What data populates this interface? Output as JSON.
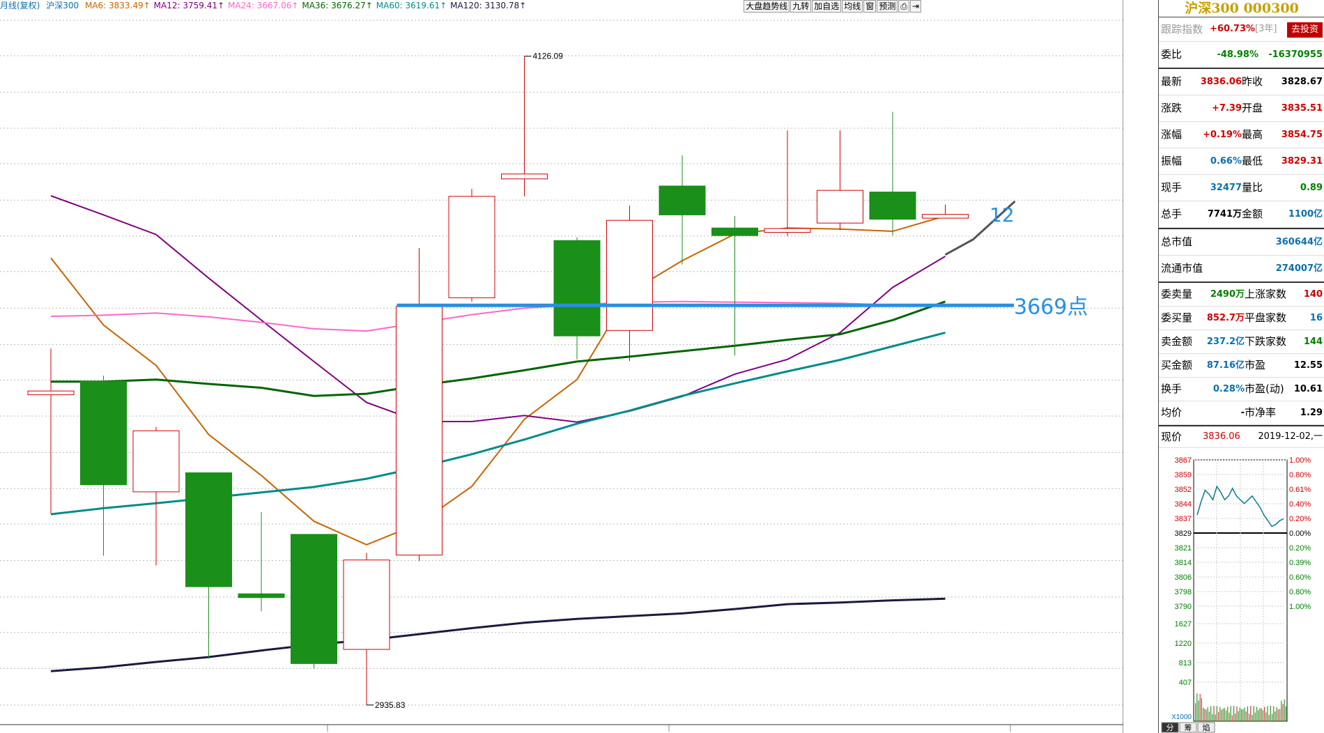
{
  "header": {
    "period_label": "月线(复权)",
    "symbol_label": "沪深300",
    "ma": [
      {
        "label": "MA6:",
        "value": "3833.49",
        "arrow": "↑",
        "color": "#c86400"
      },
      {
        "label": "MA12:",
        "value": "3759.41",
        "arrow": "↑",
        "color": "#800080"
      },
      {
        "label": "MA24:",
        "value": "3667.06",
        "arrow": "↑",
        "color": "#ff66cc"
      },
      {
        "label": "MA36:",
        "value": "3676.27",
        "arrow": "↑",
        "color": "#006400"
      },
      {
        "label": "MA60:",
        "value": "3619.61",
        "arrow": "↑",
        "color": "#008b8b"
      },
      {
        "label": "MA120:",
        "value": "3130.78",
        "arrow": "↑",
        "color": "#1a1a40"
      }
    ]
  },
  "toolbar": {
    "items": [
      "大盘趋势线",
      "九转",
      "加自选",
      "均线",
      "窗",
      "预测",
      "⎙",
      "⇥"
    ]
  },
  "chart_data": {
    "type": "candlestick",
    "y_ticks": [
      "4192",
      "4127",
      "4060",
      "3994",
      "3929",
      "3862",
      "3796",
      "3731",
      "3664",
      "3597",
      "3532",
      "3466",
      "3399",
      "3333",
      "3268",
      "3201",
      "3134",
      "3069",
      "3003",
      "2936"
    ],
    "ylim": [
      2900,
      4210
    ],
    "candles": [
      {
        "o": 3505,
        "h": 3590,
        "l": 3287,
        "c": 3512
      },
      {
        "o": 3530,
        "h": 3540,
        "l": 3210,
        "c": 3340
      },
      {
        "o": 3327,
        "h": 3446,
        "l": 3192,
        "c": 3439
      },
      {
        "o": 3362,
        "h": 3362,
        "l": 3021,
        "c": 3153
      },
      {
        "o": 3140,
        "h": 3290,
        "l": 3108,
        "c": 3133
      },
      {
        "o": 3249,
        "h": 3249,
        "l": 3003,
        "c": 3012
      },
      {
        "o": 3038,
        "h": 3215,
        "l": 2936,
        "c": 3202
      },
      {
        "o": 3211,
        "h": 3774,
        "l": 3200,
        "c": 3667
      },
      {
        "o": 3683,
        "h": 3883,
        "l": 3676,
        "c": 3869
      },
      {
        "o": 3901,
        "h": 4126,
        "l": 3869,
        "c": 3910
      },
      {
        "o": 3788,
        "h": 3794,
        "l": 3570,
        "c": 3613
      },
      {
        "o": 3623,
        "h": 3852,
        "l": 3567,
        "c": 3825
      },
      {
        "o": 3888,
        "h": 3944,
        "l": 3744,
        "c": 3835
      },
      {
        "o": 3811,
        "h": 3833,
        "l": 3577,
        "c": 3797
      },
      {
        "o": 3803,
        "h": 3990,
        "l": 3796,
        "c": 3810
      },
      {
        "o": 3820,
        "h": 3990,
        "l": 3807,
        "c": 3880
      },
      {
        "o": 3877,
        "h": 4024,
        "l": 3797,
        "c": 3827
      },
      {
        "o": 3829,
        "h": 3854,
        "l": 3829,
        "c": 3836
      }
    ],
    "series": [
      {
        "name": "MA6",
        "color": "#c86400",
        "values": [
          3756,
          3633,
          3559,
          3432,
          3357,
          3273,
          3230,
          3269,
          3337,
          3460,
          3533,
          3693,
          3751,
          3800,
          3811,
          3809,
          3805,
          3833
        ]
      },
      {
        "name": "MA12",
        "color": "#800080",
        "values": [
          3870,
          3835,
          3799,
          3719,
          3642,
          3566,
          3491,
          3456,
          3456,
          3467,
          3455,
          3475,
          3502,
          3543,
          3570,
          3619,
          3702,
          3759
        ]
      },
      {
        "name": "MA24",
        "color": "#ff66cc",
        "values": [
          3649,
          3651,
          3655,
          3648,
          3638,
          3626,
          3622,
          3637,
          3652,
          3664,
          3670,
          3675,
          3676,
          3675,
          3674,
          3673,
          3670,
          3667
        ]
      },
      {
        "name": "MA36",
        "color": "#006400",
        "values": [
          3529,
          3529,
          3533,
          3525,
          3518,
          3503,
          3507,
          3522,
          3535,
          3550,
          3566,
          3575,
          3585,
          3595,
          3606,
          3616,
          3642,
          3676
        ]
      },
      {
        "name": "MA60",
        "color": "#008b8b",
        "values": [
          3286,
          3297,
          3306,
          3316,
          3326,
          3336,
          3351,
          3372,
          3396,
          3423,
          3452,
          3476,
          3503,
          3526,
          3548,
          3569,
          3594,
          3619
        ]
      },
      {
        "name": "MA120",
        "color": "#1a1a40",
        "values": [
          2998,
          3005,
          3015,
          3024,
          3036,
          3047,
          3055,
          3066,
          3077,
          3087,
          3094,
          3099,
          3104,
          3112,
          3121,
          3124,
          3128,
          3131
        ]
      }
    ],
    "labels": {
      "high": "4126.09",
      "low": "2935.83"
    },
    "annotations": {
      "level_text": "3669点",
      "level_value": 3669,
      "count_text": "12"
    }
  },
  "panel": {
    "title": "沪深300 000300",
    "track_label": "跟踪指数",
    "track_value": "+60.73%",
    "track_years": "[3年]",
    "invest_button": "去投资",
    "weibi_label": "委比",
    "weibi_pct": "-48.98%",
    "weibi_val": "-16370955",
    "rows": [
      {
        "l1": "最新",
        "v1": "3836.06",
        "c1": "red",
        "l2": "昨收",
        "v2": "3828.67",
        "c2": "black"
      },
      {
        "l1": "涨跌",
        "v1": "+7.39",
        "c1": "red",
        "l2": "开盘",
        "v2": "3835.51",
        "c2": "red"
      },
      {
        "l1": "涨幅",
        "v1": "+0.19%",
        "c1": "red",
        "l2": "最高",
        "v2": "3854.75",
        "c2": "red"
      },
      {
        "l1": "振幅",
        "v1": "0.66%",
        "c1": "blue",
        "l2": "最低",
        "v2": "3829.31",
        "c2": "red"
      },
      {
        "l1": "现手",
        "v1": "32477",
        "c1": "blue",
        "l2": "量比",
        "v2": "0.89",
        "c2": "green"
      },
      {
        "l1": "总手",
        "v1": "7741万",
        "c1": "black",
        "l2": "金额",
        "v2": "1100亿",
        "c2": "blue"
      }
    ],
    "mkt_total_label": "总市值",
    "mkt_total": "360644亿",
    "mkt_float_label": "流通市值",
    "mkt_float": "274007亿",
    "stats": [
      {
        "l1": "委卖量",
        "v1": "2490万",
        "c1": "green",
        "l2": "上涨家数",
        "v2": "140",
        "c2": "red"
      },
      {
        "l1": "委买量",
        "v1": "852.7万",
        "c1": "red",
        "l2": "平盘家数",
        "v2": "16",
        "c2": "blue"
      },
      {
        "l1": "卖金额",
        "v1": "237.2亿",
        "c1": "blue",
        "l2": "下跌家数",
        "v2": "144",
        "c2": "green"
      },
      {
        "l1": "买金额",
        "v1": "87.16亿",
        "c1": "blue",
        "l2": "市盈",
        "v2": "12.55",
        "c2": "black"
      },
      {
        "l1": "换手",
        "v1": "0.28%",
        "c1": "blue",
        "l2": "市盈(动)",
        "v2": "10.61",
        "c2": "black"
      },
      {
        "l1": "均价",
        "v1": "-",
        "c1": "black",
        "l2": "市净率",
        "v2": "1.29",
        "c2": "black"
      }
    ],
    "now_label": "现价",
    "now_value": "3836.06",
    "now_date": "2019-12-02,一",
    "mini": {
      "left_ticks": [
        "3867",
        "3859",
        "3852",
        "3844",
        "3837",
        "3829",
        "3821",
        "3814",
        "3806",
        "3798",
        "3790"
      ],
      "right_ticks": [
        "1.00%",
        "0.80%",
        "0.61%",
        "0.40%",
        "0.20%",
        "0.00%",
        "0.20%",
        "0.39%",
        "0.60%",
        "0.80%",
        "1.00%"
      ],
      "vol_ticks": [
        "1627",
        "1220",
        "813",
        "407"
      ],
      "vol_unit": "X1000",
      "ylim": [
        3790,
        3867
      ],
      "prices": [
        3838,
        3845,
        3851,
        3849,
        3846,
        3853,
        3850,
        3846,
        3848,
        3852,
        3848,
        3846,
        3844,
        3846,
        3848,
        3845,
        3842,
        3838,
        3835,
        3832,
        3833,
        3835,
        3836
      ],
      "tabs": [
        "分",
        "筹",
        "焰"
      ]
    }
  }
}
